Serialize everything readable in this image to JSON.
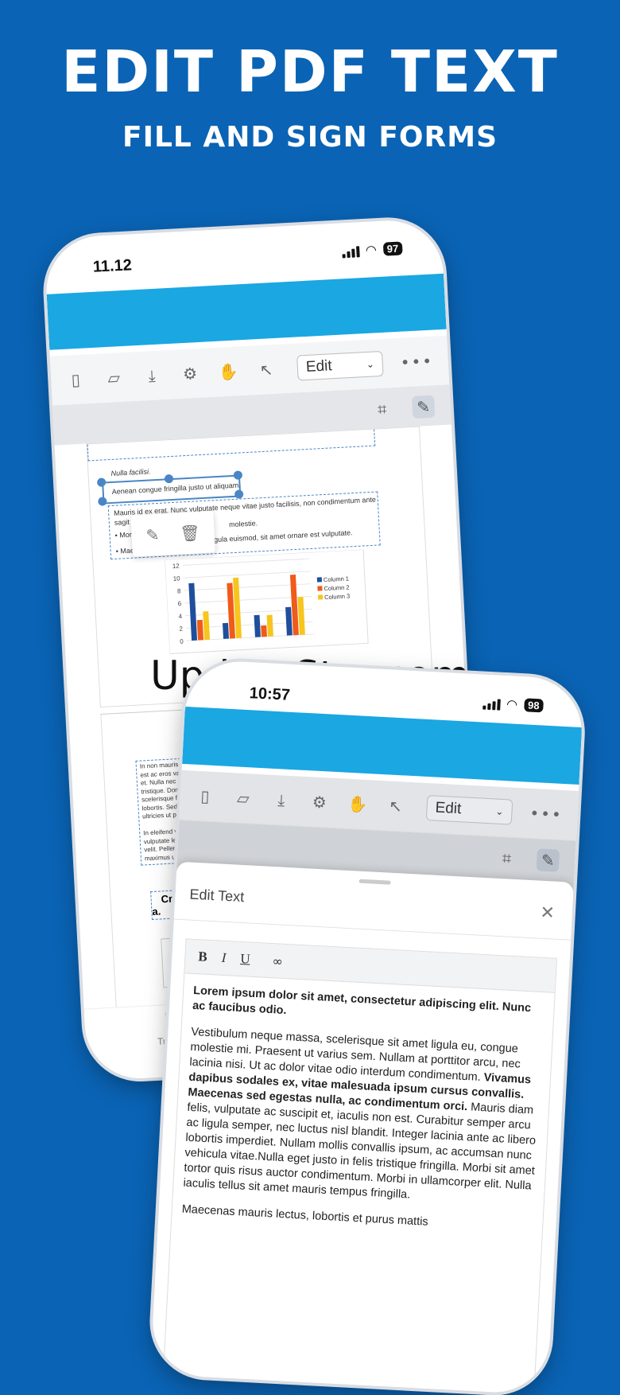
{
  "hero": {
    "title": "EDIT PDF TEXT",
    "subtitle": "FILL AND SIGN FORMS"
  },
  "watermark": "UpdateStar.com",
  "phone1": {
    "status": {
      "time": "11.12",
      "battery": "97"
    },
    "toolbar": {
      "icons": [
        "sidebar-icon",
        "folder-icon",
        "download-icon",
        "settings-doc-icon",
        "hand-icon",
        "select-icon"
      ],
      "mode_label": "Edit",
      "more": "•••"
    },
    "doc": {
      "line_italic": "Nulla facilisi.",
      "line_selected": "Aenean congue fringilla justo ut aliquam.",
      "para1": "Mauris id ex erat. Nunc vulputate neque vitae justo facilisis, non condimentum ante",
      "para1b": "sagit",
      "bullet1": "Morb",
      "bullet1b": "molestie.",
      "bullet2": "Maec",
      "bullet2b": "gula euismod, sit amet ornare est vulputate.",
      "col_lines": [
        "In non mauris j",
        "est ac eros var",
        "et. Nulla nec",
        "tristique. Done",
        "scelerisque fe",
        "lobortis. Sed i",
        "ultricies ut p",
        "",
        "In eleifend v",
        "vulputate le",
        "velit. Pellen",
        "maximus ul"
      ],
      "heading_frag": "Cra",
      "heading_frag2": "a."
    },
    "bottom_tab": "Translate"
  },
  "chart_data": {
    "type": "bar",
    "categories": [
      "",
      "",
      "",
      ""
    ],
    "series": [
      {
        "name": "Column 1",
        "values": [
          9.1,
          2.5,
          3.5,
          4.5
        ]
      },
      {
        "name": "Column 2",
        "values": [
          3.2,
          8.8,
          1.8,
          9.6
        ]
      },
      {
        "name": "Column 3",
        "values": [
          4.5,
          9.6,
          3.4,
          6.0
        ]
      }
    ],
    "ylim": [
      0,
      12
    ],
    "yticks": [
      "0",
      "2",
      "4",
      "6",
      "8",
      "10",
      "12"
    ],
    "colors": [
      "#1f4e9c",
      "#f05a1a",
      "#f7c51e"
    ],
    "legend": "right"
  },
  "phone2": {
    "status": {
      "time": "10:57",
      "battery": "98"
    },
    "toolbar": {
      "mode_label": "Edit",
      "more": "•••"
    },
    "sheet": {
      "title": "Edit Text",
      "format_buttons": [
        "B",
        "I",
        "U"
      ],
      "bold_lead": "Lorem ipsum dolor sit amet, consectetur adipiscing elit. Nunc ac faucibus odio.",
      "body_a": "Vestibulum neque massa, scelerisque sit amet ligula eu, congue molestie mi. Praesent ut varius sem. Nullam at porttitor arcu, nec lacinia nisi. Ut ac dolor vitae odio interdum condimentum. ",
      "body_bold": "Vivamus dapibus sodales ex, vitae malesuada ipsum cursus convallis. Maecenas sed egestas nulla, ac condimentum orci.",
      "body_b": " Mauris diam felis, vulputate ac suscipit et, iaculis non est. Curabitur semper arcu ac ligula semper, nec luctus nisl blandit. Integer lacinia ante ac libero lobortis imperdiet. Nullam mollis convallis ipsum, ac accumsan nunc vehicula vitae.Nulla eget justo in felis tristique fringilla. Morbi sit amet tortor quis risus auctor condimentum. Morbi in ullamcorper elit. Nulla iaculis tellus sit amet mauris tempus fringilla.",
      "body_c": "Maecenas mauris lectus, lobortis et purus mattis"
    }
  }
}
